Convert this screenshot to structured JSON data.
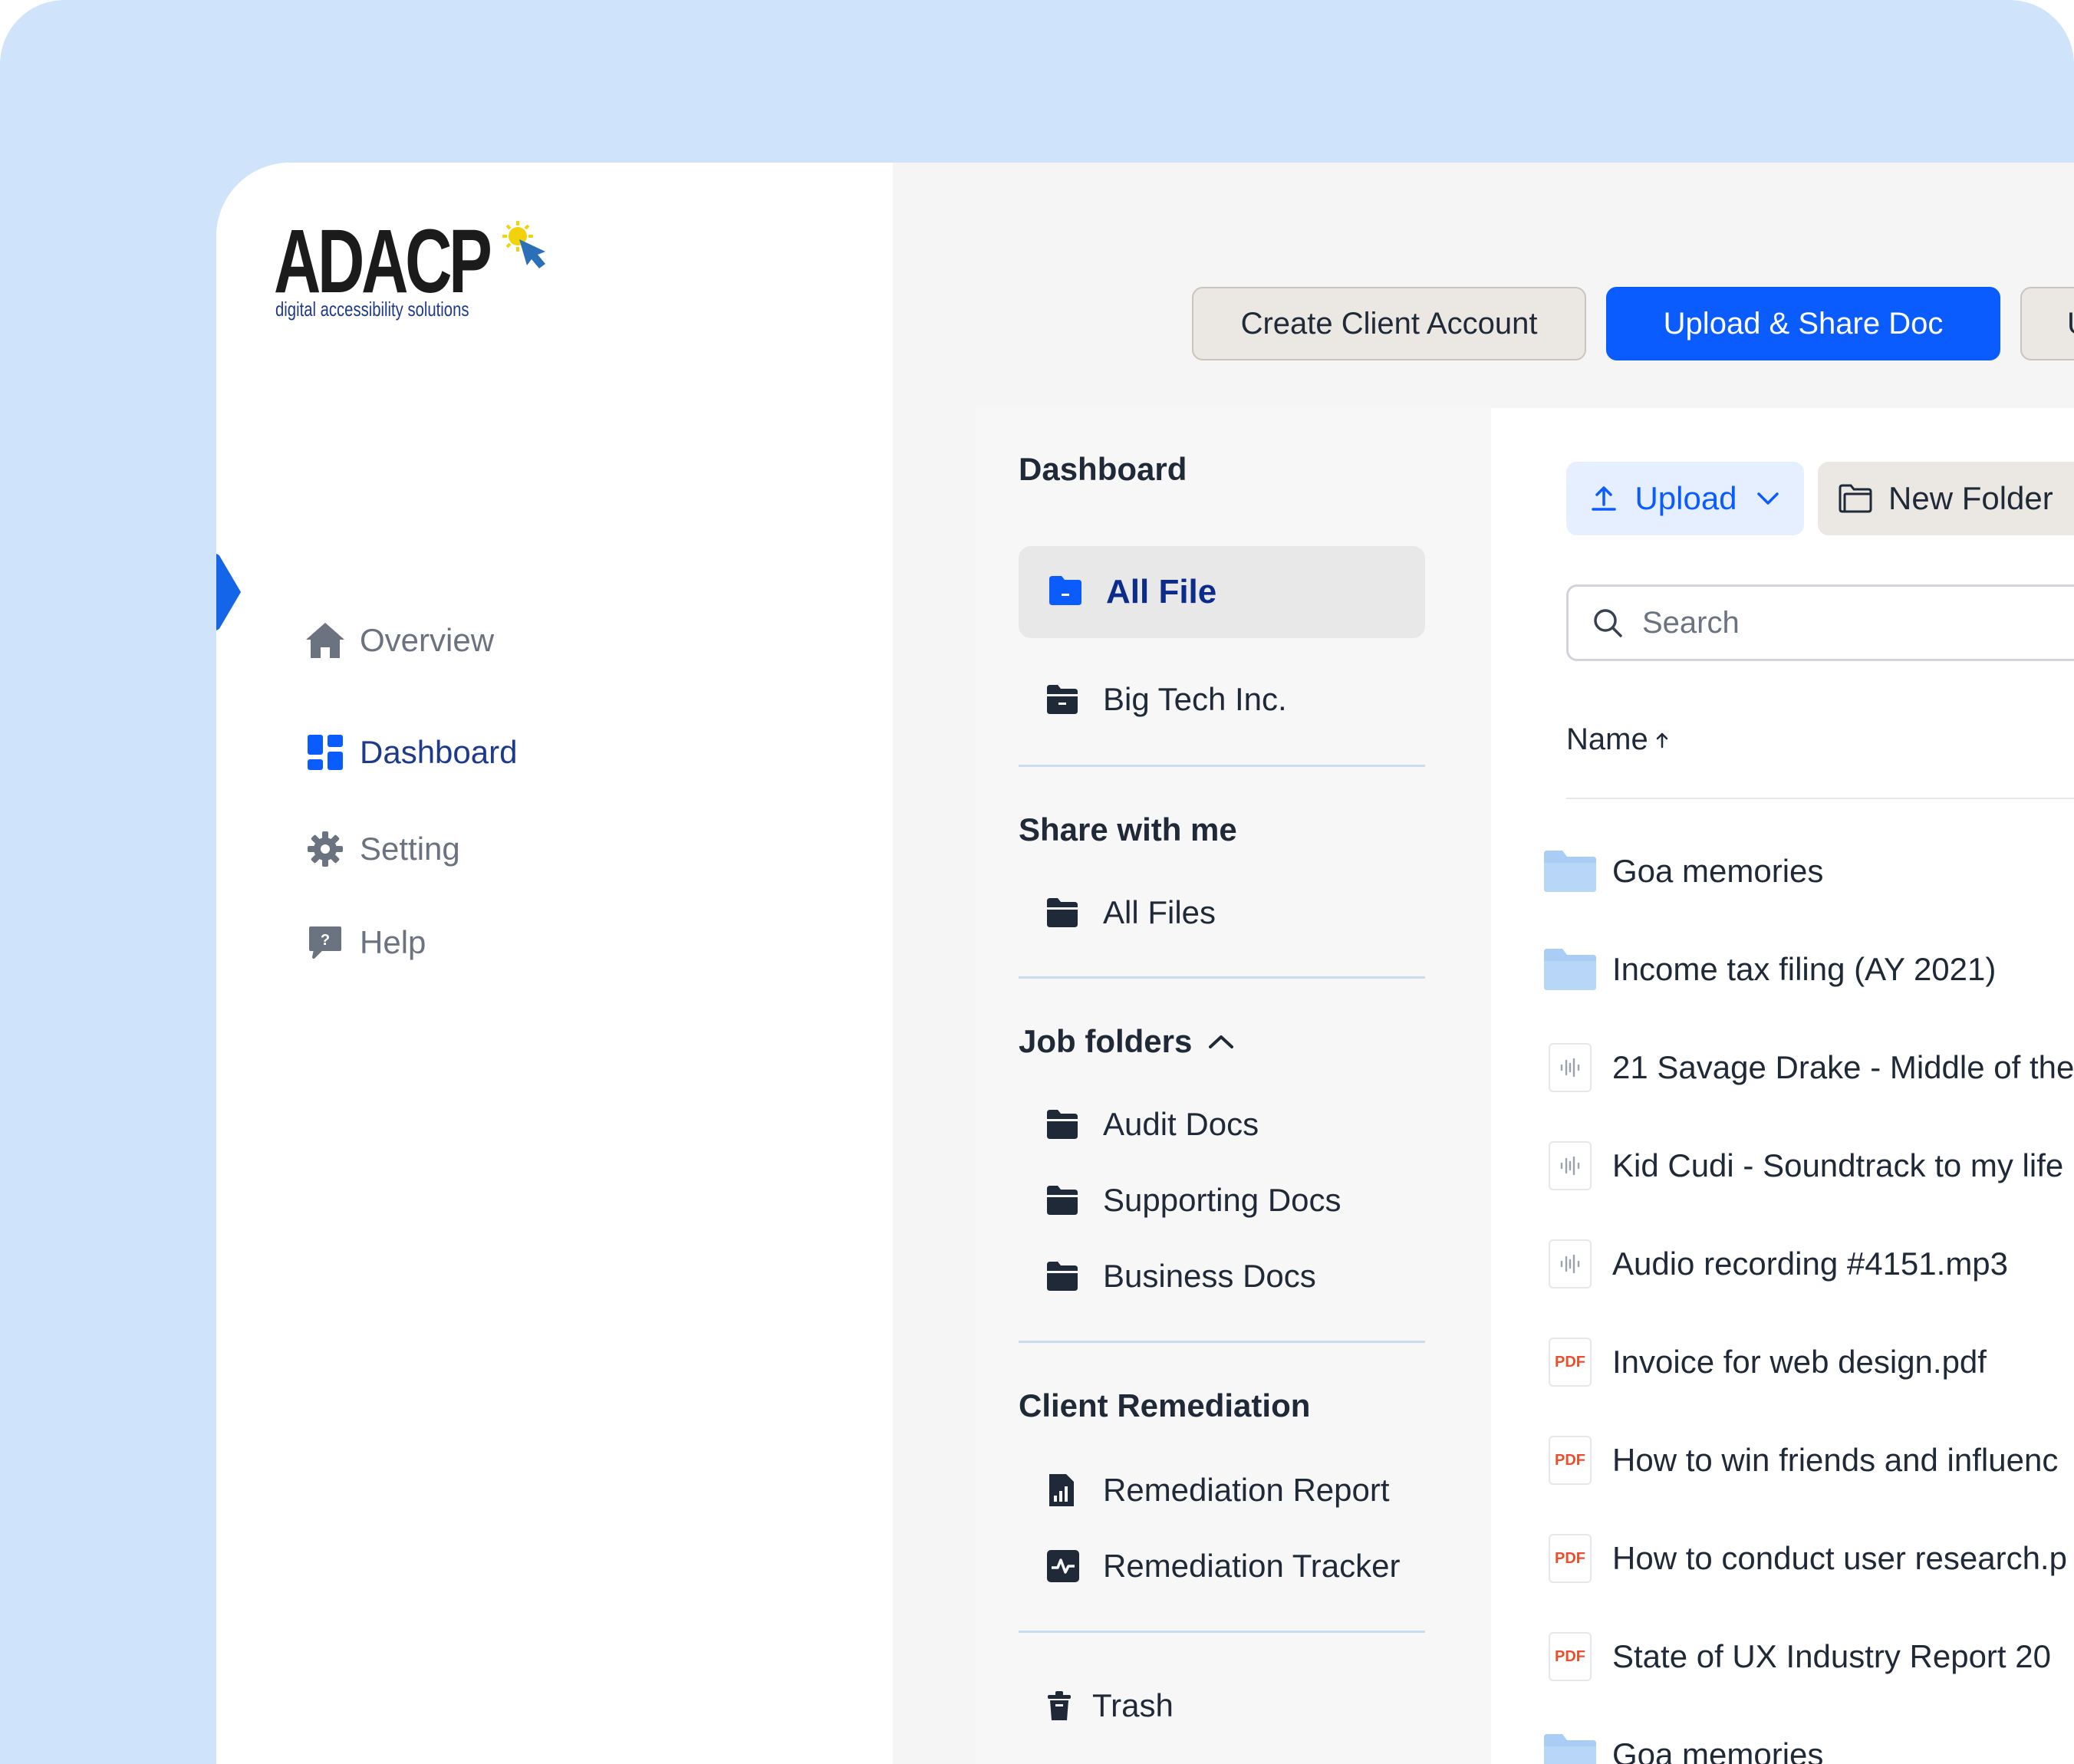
{
  "logo": {
    "wordmark": "ADACP",
    "tagline": "digital accessibility solutions"
  },
  "nav": [
    {
      "label": "Overview",
      "icon": "home-icon"
    },
    {
      "label": "Dashboard",
      "icon": "dashboard-grid-icon",
      "active": true
    },
    {
      "label": "Setting",
      "icon": "gear-icon"
    },
    {
      "label": "Help",
      "icon": "help-bubble-icon"
    }
  ],
  "top_buttons": {
    "create_client": "Create Client Account",
    "upload_share": "Upload & Share Doc",
    "user_account": "User Account"
  },
  "folders_panel": {
    "title": "Dashboard",
    "all_file": "All File",
    "big_tech": "Big Tech Inc.",
    "share_title": "Share with me",
    "share_all_files": "All Files",
    "job_title": "Job folders",
    "job_items": [
      "Audit Docs",
      "Supporting Docs",
      "Business Docs"
    ],
    "client_title": "Client Remediation",
    "client_items": [
      "Remediation Report",
      "Remediation Tracker"
    ],
    "trash": "Trash"
  },
  "files_panel": {
    "upload_label": "Upload",
    "new_folder_label": "New Folder",
    "search_placeholder": "Search",
    "name_column": "Name",
    "rows": [
      {
        "name": "Goa memories",
        "type": "folder"
      },
      {
        "name": "Income tax filing (AY 2021)",
        "type": "folder"
      },
      {
        "name": "21 Savage Drake - Middle of the",
        "type": "audio"
      },
      {
        "name": "Kid Cudi - Soundtrack to my life",
        "type": "audio"
      },
      {
        "name": "Audio recording #4151.mp3",
        "type": "audio"
      },
      {
        "name": "Invoice for web design.pdf",
        "type": "pdf"
      },
      {
        "name": "How to win friends and influenc",
        "type": "pdf"
      },
      {
        "name": "How to conduct user research.p",
        "type": "pdf"
      },
      {
        "name": "State of UX Industry Report 20",
        "type": "pdf"
      },
      {
        "name": "Goa memories",
        "type": "folder"
      }
    ],
    "pdf_badge": "PDF"
  },
  "colors": {
    "background_blue": "#cfe3fb",
    "accent": "#0b5cff",
    "active_nav": "#1e3a8a",
    "folder_light": "#a9cdf5",
    "pdf_badge": "#e8512c"
  }
}
